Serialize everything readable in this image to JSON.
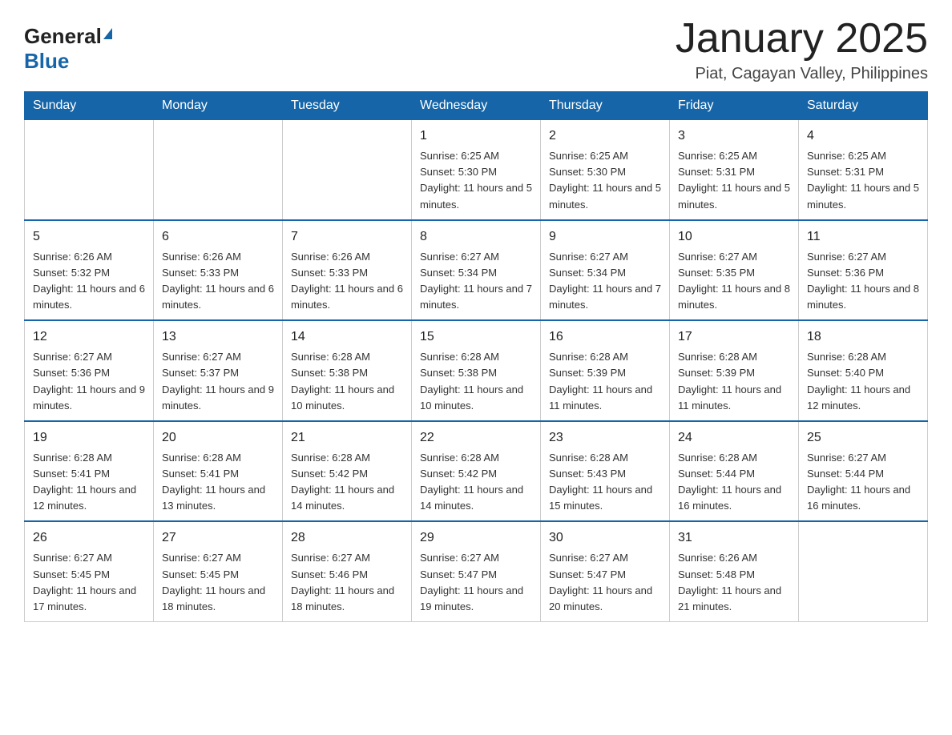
{
  "header": {
    "logo_general": "General",
    "logo_blue": "Blue",
    "month_title": "January 2025",
    "subtitle": "Piat, Cagayan Valley, Philippines"
  },
  "days_of_week": [
    "Sunday",
    "Monday",
    "Tuesday",
    "Wednesday",
    "Thursday",
    "Friday",
    "Saturday"
  ],
  "weeks": [
    [
      {
        "day": "",
        "info": ""
      },
      {
        "day": "",
        "info": ""
      },
      {
        "day": "",
        "info": ""
      },
      {
        "day": "1",
        "info": "Sunrise: 6:25 AM\nSunset: 5:30 PM\nDaylight: 11 hours and 5 minutes."
      },
      {
        "day": "2",
        "info": "Sunrise: 6:25 AM\nSunset: 5:30 PM\nDaylight: 11 hours and 5 minutes."
      },
      {
        "day": "3",
        "info": "Sunrise: 6:25 AM\nSunset: 5:31 PM\nDaylight: 11 hours and 5 minutes."
      },
      {
        "day": "4",
        "info": "Sunrise: 6:25 AM\nSunset: 5:31 PM\nDaylight: 11 hours and 5 minutes."
      }
    ],
    [
      {
        "day": "5",
        "info": "Sunrise: 6:26 AM\nSunset: 5:32 PM\nDaylight: 11 hours and 6 minutes."
      },
      {
        "day": "6",
        "info": "Sunrise: 6:26 AM\nSunset: 5:33 PM\nDaylight: 11 hours and 6 minutes."
      },
      {
        "day": "7",
        "info": "Sunrise: 6:26 AM\nSunset: 5:33 PM\nDaylight: 11 hours and 6 minutes."
      },
      {
        "day": "8",
        "info": "Sunrise: 6:27 AM\nSunset: 5:34 PM\nDaylight: 11 hours and 7 minutes."
      },
      {
        "day": "9",
        "info": "Sunrise: 6:27 AM\nSunset: 5:34 PM\nDaylight: 11 hours and 7 minutes."
      },
      {
        "day": "10",
        "info": "Sunrise: 6:27 AM\nSunset: 5:35 PM\nDaylight: 11 hours and 8 minutes."
      },
      {
        "day": "11",
        "info": "Sunrise: 6:27 AM\nSunset: 5:36 PM\nDaylight: 11 hours and 8 minutes."
      }
    ],
    [
      {
        "day": "12",
        "info": "Sunrise: 6:27 AM\nSunset: 5:36 PM\nDaylight: 11 hours and 9 minutes."
      },
      {
        "day": "13",
        "info": "Sunrise: 6:27 AM\nSunset: 5:37 PM\nDaylight: 11 hours and 9 minutes."
      },
      {
        "day": "14",
        "info": "Sunrise: 6:28 AM\nSunset: 5:38 PM\nDaylight: 11 hours and 10 minutes."
      },
      {
        "day": "15",
        "info": "Sunrise: 6:28 AM\nSunset: 5:38 PM\nDaylight: 11 hours and 10 minutes."
      },
      {
        "day": "16",
        "info": "Sunrise: 6:28 AM\nSunset: 5:39 PM\nDaylight: 11 hours and 11 minutes."
      },
      {
        "day": "17",
        "info": "Sunrise: 6:28 AM\nSunset: 5:39 PM\nDaylight: 11 hours and 11 minutes."
      },
      {
        "day": "18",
        "info": "Sunrise: 6:28 AM\nSunset: 5:40 PM\nDaylight: 11 hours and 12 minutes."
      }
    ],
    [
      {
        "day": "19",
        "info": "Sunrise: 6:28 AM\nSunset: 5:41 PM\nDaylight: 11 hours and 12 minutes."
      },
      {
        "day": "20",
        "info": "Sunrise: 6:28 AM\nSunset: 5:41 PM\nDaylight: 11 hours and 13 minutes."
      },
      {
        "day": "21",
        "info": "Sunrise: 6:28 AM\nSunset: 5:42 PM\nDaylight: 11 hours and 14 minutes."
      },
      {
        "day": "22",
        "info": "Sunrise: 6:28 AM\nSunset: 5:42 PM\nDaylight: 11 hours and 14 minutes."
      },
      {
        "day": "23",
        "info": "Sunrise: 6:28 AM\nSunset: 5:43 PM\nDaylight: 11 hours and 15 minutes."
      },
      {
        "day": "24",
        "info": "Sunrise: 6:28 AM\nSunset: 5:44 PM\nDaylight: 11 hours and 16 minutes."
      },
      {
        "day": "25",
        "info": "Sunrise: 6:27 AM\nSunset: 5:44 PM\nDaylight: 11 hours and 16 minutes."
      }
    ],
    [
      {
        "day": "26",
        "info": "Sunrise: 6:27 AM\nSunset: 5:45 PM\nDaylight: 11 hours and 17 minutes."
      },
      {
        "day": "27",
        "info": "Sunrise: 6:27 AM\nSunset: 5:45 PM\nDaylight: 11 hours and 18 minutes."
      },
      {
        "day": "28",
        "info": "Sunrise: 6:27 AM\nSunset: 5:46 PM\nDaylight: 11 hours and 18 minutes."
      },
      {
        "day": "29",
        "info": "Sunrise: 6:27 AM\nSunset: 5:47 PM\nDaylight: 11 hours and 19 minutes."
      },
      {
        "day": "30",
        "info": "Sunrise: 6:27 AM\nSunset: 5:47 PM\nDaylight: 11 hours and 20 minutes."
      },
      {
        "day": "31",
        "info": "Sunrise: 6:26 AM\nSunset: 5:48 PM\nDaylight: 11 hours and 21 minutes."
      },
      {
        "day": "",
        "info": ""
      }
    ]
  ]
}
